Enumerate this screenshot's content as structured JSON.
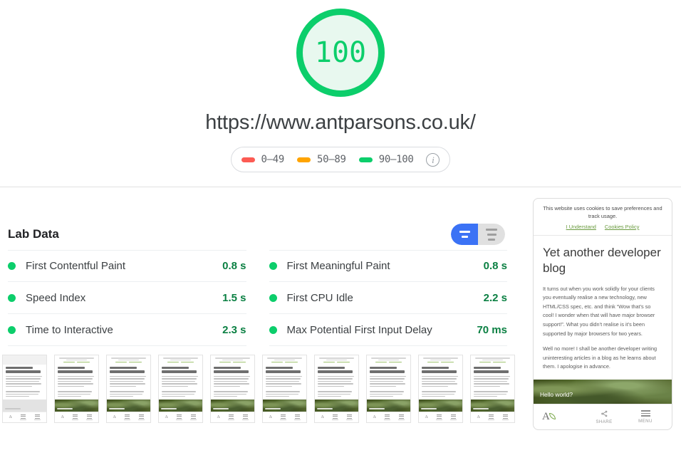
{
  "report": {
    "score": "100",
    "url": "https://www.antparsons.co.uk/",
    "score_color": "#0cce6b",
    "score_bg": "#e8f8ef"
  },
  "legend": {
    "items": [
      {
        "label": "0–49",
        "color": "#fc5b53",
        "icon": "score-swatch-red"
      },
      {
        "label": "50–89",
        "color": "#ffa400",
        "icon": "score-swatch-orange"
      },
      {
        "label": "90–100",
        "color": "#0cce6b",
        "icon": "score-swatch-green"
      }
    ],
    "info_icon": "info-icon",
    "info_glyph": "i"
  },
  "lab_data": {
    "title": "Lab Data",
    "view_toggle": {
      "active": "compact-view",
      "options": [
        {
          "name": "compact-view",
          "icon": "two-bars-icon",
          "active": true
        },
        {
          "name": "list-view",
          "icon": "three-bars-icon",
          "active": false
        }
      ]
    },
    "metrics_left": [
      {
        "name": "First Contentful Paint",
        "value": "0.8 s",
        "status": "pass"
      },
      {
        "name": "Speed Index",
        "value": "1.5 s",
        "status": "pass"
      },
      {
        "name": "Time to Interactive",
        "value": "2.3 s",
        "status": "pass"
      }
    ],
    "metrics_right": [
      {
        "name": "First Meaningful Paint",
        "value": "0.8 s",
        "status": "pass"
      },
      {
        "name": "First CPU Idle",
        "value": "2.2 s",
        "status": "pass"
      },
      {
        "name": "Max Potential First Input Delay",
        "value": "70 ms",
        "status": "pass"
      }
    ],
    "pass_color": "#0b8043",
    "dot_color": "#0cce6b"
  },
  "filmstrip": {
    "frame_count": 10,
    "frames": [
      {
        "loaded": false
      },
      {
        "loaded": true
      },
      {
        "loaded": true
      },
      {
        "loaded": true
      },
      {
        "loaded": true
      },
      {
        "loaded": true
      },
      {
        "loaded": true
      },
      {
        "loaded": true
      },
      {
        "loaded": true
      },
      {
        "loaded": true
      }
    ]
  },
  "preview": {
    "cookie_notice": {
      "text": "This website uses cookies to save preferences and track usage.",
      "accept_label": "I Understand",
      "policy_label": "Cookies Policy"
    },
    "heading": "Yet another developer blog",
    "paragraphs": [
      "It turns out when you work solidly for your clients you eventually realise a new technology, new HTML/CSS spec, etc. and think “Wow that’s so cool! I wonder when that will have major browser support!”. What you didn’t realise is it’s been supported by major browsers for two years.",
      "Well no more! I shall be another developer writing uninteresting articles in a blog as he learns about them. I apologise in advance."
    ],
    "hero_caption": "Hello world?",
    "footer": {
      "logo_letter": "A",
      "share_label": "SHARE",
      "menu_label": "MENU"
    }
  }
}
